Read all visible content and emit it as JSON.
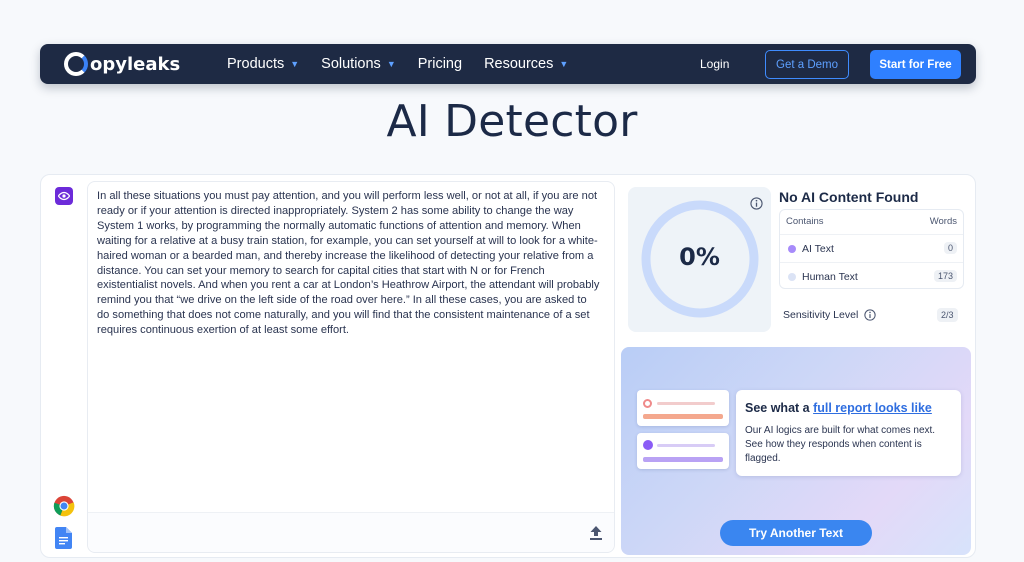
{
  "nav": {
    "brand": "opyleaks",
    "items": [
      {
        "label": "Products",
        "dropdown": true
      },
      {
        "label": "Solutions",
        "dropdown": true
      },
      {
        "label": "Pricing",
        "dropdown": false
      },
      {
        "label": "Resources",
        "dropdown": true
      }
    ],
    "login": "Login",
    "demo": "Get a Demo",
    "start": "Start for Free"
  },
  "page_title": "AI Detector",
  "editor": {
    "text": "In all these situations you must pay attention, and you will perform less well, or not at all, if you are not ready or if your attention is directed inappropriately. System 2 has some ability to change the way System 1 works, by programming the normally automatic functions of attention and memory. When waiting for a relative at a busy train station, for example, you can set yourself at will to look for a white-haired woman or a bearded man, and thereby increase the likelihood of detecting your relative from a distance. You can set your memory to search for capital cities that start with N or for French existentialist novels. And when you rent a car at London’s Heathrow Airport, the attendant will probably remind you that “we drive on the left side of the road over here.” In all these cases, you are asked to do something that does not come naturally, and you will find that the consistent maintenance of a set requires continuous exertion of at least some effort."
  },
  "result": {
    "percent": "0%",
    "percent_value": 0,
    "title": "No AI Content Found",
    "col_contains": "Contains",
    "col_words": "Words",
    "rows": [
      {
        "label": "AI Text",
        "count": "0",
        "color": "#a78bfa"
      },
      {
        "label": "Human Text",
        "count": "173",
        "color": "#dbe3f5"
      }
    ],
    "sensitivity_label": "Sensitivity Level",
    "sensitivity_value": "2/3"
  },
  "promo": {
    "head_prefix": "See what a ",
    "head_link": "full report looks like",
    "body": "Our AI logics are built for what comes next. See how they responds when content is flagged.",
    "button": "Try Another Text"
  },
  "colors": {
    "nav_bg": "#1e2a44",
    "accent": "#2f80ff",
    "gauge_ring": "#c9dafb"
  }
}
